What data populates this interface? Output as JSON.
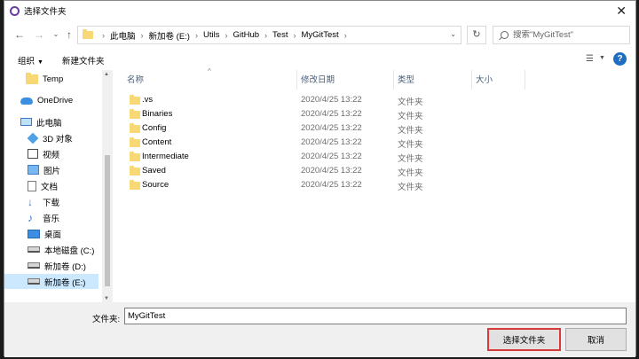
{
  "window": {
    "title": "选择文件夹"
  },
  "breadcrumbs": [
    "此电脑",
    "新加卷 (E:)",
    "Utils",
    "GitHub",
    "Test",
    "MyGitTest"
  ],
  "search": {
    "placeholder": "搜索\"MyGitTest\""
  },
  "toolbar": {
    "organize_label": "组织",
    "new_folder_label": "新建文件夹",
    "help_label": "?"
  },
  "sidebar": {
    "items": [
      {
        "label": "Temp",
        "icon": "folder-icon"
      },
      {
        "label": "OneDrive",
        "icon": "onedrive-icon"
      },
      {
        "label": "此电脑",
        "icon": "this-pc-icon"
      },
      {
        "label": "3D 对象",
        "icon": "3d-objects-icon"
      },
      {
        "label": "视频",
        "icon": "videos-icon"
      },
      {
        "label": "图片",
        "icon": "pictures-icon"
      },
      {
        "label": "文档",
        "icon": "documents-icon"
      },
      {
        "label": "下载",
        "icon": "downloads-icon"
      },
      {
        "label": "音乐",
        "icon": "music-icon"
      },
      {
        "label": "桌面",
        "icon": "desktop-icon"
      },
      {
        "label": "本地磁盘 (C:)",
        "icon": "drive-icon"
      },
      {
        "label": "新加卷 (D:)",
        "icon": "drive-icon"
      },
      {
        "label": "新加卷 (E:)",
        "icon": "drive-icon",
        "selected": true
      }
    ]
  },
  "filelist": {
    "columns": {
      "name": "名称",
      "date": "修改日期",
      "type": "类型",
      "size": "大小"
    },
    "rows": [
      {
        "name": ".vs",
        "date": "2020/4/25 13:22",
        "type": "文件夹"
      },
      {
        "name": "Binaries",
        "date": "2020/4/25 13:22",
        "type": "文件夹"
      },
      {
        "name": "Config",
        "date": "2020/4/25 13:22",
        "type": "文件夹"
      },
      {
        "name": "Content",
        "date": "2020/4/25 13:22",
        "type": "文件夹"
      },
      {
        "name": "Intermediate",
        "date": "2020/4/25 13:22",
        "type": "文件夹"
      },
      {
        "name": "Saved",
        "date": "2020/4/25 13:22",
        "type": "文件夹"
      },
      {
        "name": "Source",
        "date": "2020/4/25 13:22",
        "type": "文件夹"
      }
    ]
  },
  "bottom": {
    "folder_label": "文件夹:",
    "folder_value": "MyGitTest",
    "select_label": "选择文件夹",
    "cancel_label": "取消"
  },
  "colors": {
    "accent": "#1e6fc4",
    "folder": "#f8d775",
    "selection": "#cce8ff",
    "highlight_box": "#d63a3a"
  }
}
